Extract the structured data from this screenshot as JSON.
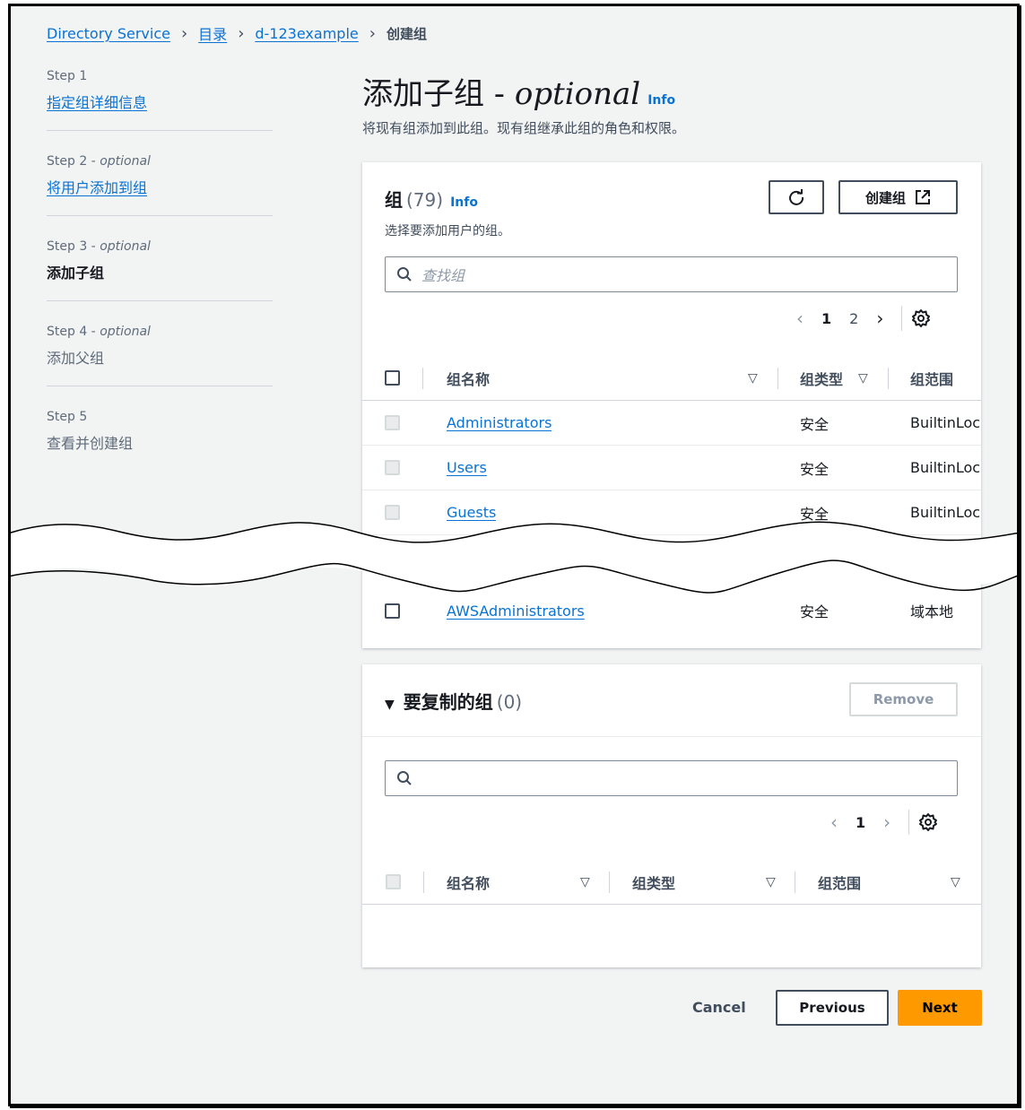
{
  "breadcrumb": {
    "items": [
      "Directory Service",
      "目录",
      "d-123example"
    ],
    "current": "创建组"
  },
  "steps": [
    {
      "num": "Step 1",
      "opt": "",
      "label": "指定组详细信息"
    },
    {
      "num": "Step 2 - ",
      "opt": "optional",
      "label": "将用户添加到组"
    },
    {
      "num": "Step 3 - ",
      "opt": "optional",
      "label": "添加子组"
    },
    {
      "num": "Step 4 - ",
      "opt": "optional",
      "label": "添加父组"
    },
    {
      "num": "Step 5",
      "opt": "",
      "label": "查看并创建组"
    }
  ],
  "header": {
    "title": "添加子组 - ",
    "title_optional": "optional",
    "info": "Info",
    "description": "将现有组添加到此组。现有组继承此组的角色和权限。"
  },
  "groups_panel": {
    "title": "组",
    "count": "(79)",
    "info": "Info",
    "subtitle": "选择要添加用户的组。",
    "create_label": "创建组",
    "search_placeholder": "查找组",
    "pages": [
      "1",
      "2"
    ],
    "columns": [
      "组名称",
      "组类型",
      "组范围"
    ],
    "rows": [
      {
        "name": "Administrators",
        "type": "安全",
        "scope": "BuiltinLocal"
      },
      {
        "name": "Users",
        "type": "安全",
        "scope": "BuiltinLocal"
      },
      {
        "name": "Guests",
        "type": "安全",
        "scope": "BuiltinLocal"
      },
      {
        "name": "AWSAdministrators",
        "type": "安全",
        "scope": "域本地"
      }
    ]
  },
  "copy_panel": {
    "title": "要复制的组",
    "count": "(0)",
    "remove_label": "Remove",
    "pages": [
      "1"
    ],
    "columns": [
      "组名称",
      "组类型",
      "组范围"
    ]
  },
  "footer": {
    "cancel": "Cancel",
    "previous": "Previous",
    "next": "Next"
  },
  "colors": {
    "primary": "#ff9900",
    "link": "#0972d3",
    "background": "#f2f3f3"
  },
  "icons": [
    "chevron-right-icon",
    "refresh-icon",
    "external-link-icon",
    "search-icon",
    "chevron-left-icon",
    "settings-gear-icon",
    "sort-caret-icon",
    "caret-down-icon"
  ]
}
